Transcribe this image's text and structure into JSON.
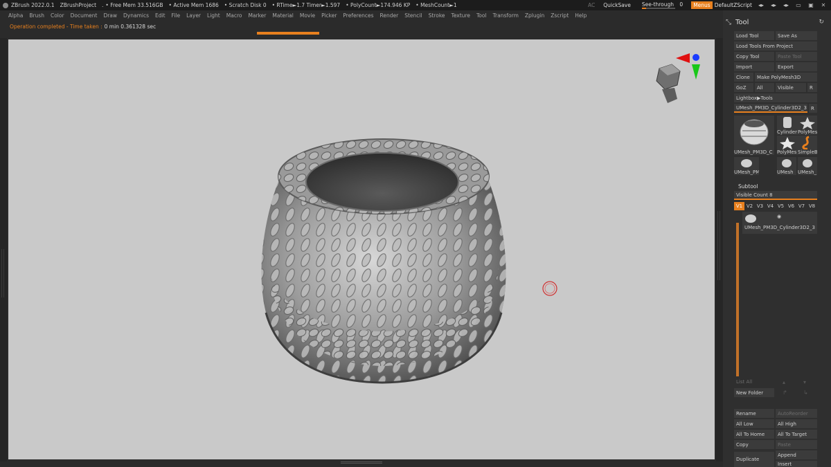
{
  "titlebar": {
    "app": "ZBrush 2022.0.1",
    "project": "ZBrushProject",
    "dot": ".",
    "free_mem": "• Free Mem 33.516GB",
    "active_mem": "• Active Mem 1686",
    "scratch": "• Scratch Disk 0",
    "rtime": "• RTime►1.7 Timer►1.597",
    "polycount": "• PolyCount►174.946 KP",
    "meshcount": "• MeshCount►1",
    "ac": "AC",
    "quicksave": "QuickSave",
    "see_through": "See-through",
    "see_through_value": "0",
    "see_through_level": 0.0,
    "menus": "Menus",
    "script": "DefaultZScript"
  },
  "menubar": {
    "items": [
      "Alpha",
      "Brush",
      "Color",
      "Document",
      "Draw",
      "Dynamics",
      "Edit",
      "File",
      "Layer",
      "Light",
      "Macro",
      "Marker",
      "Material",
      "Movie",
      "Picker",
      "Preferences",
      "Render",
      "Stencil",
      "Stroke",
      "Texture",
      "Tool",
      "Transform",
      "Zplugin",
      "Zscript",
      "Help"
    ]
  },
  "status": {
    "label": "Operation completed - Time taken :",
    "value": "0 min 0.361328 sec"
  },
  "tool_panel": {
    "title": "Tool",
    "load_tool": "Load Tool",
    "save_as": "Save As",
    "load_from_project": "Load Tools From Project",
    "copy_tool": "Copy Tool",
    "paste_tool": "Paste Tool",
    "import": "Import",
    "export": "Export",
    "clone": "Clone",
    "make_polymesh": "Make PolyMesh3D",
    "goz": "GoZ",
    "all": "All",
    "visible": "Visible",
    "r": "R",
    "lightbox": "Lightbox▶Tools",
    "current_tool": "UMesh_PM3D_Cylinder3D2_3",
    "current_tool_suffix": "R",
    "thumbs": {
      "main": "UMesh_PM3D_C",
      "cylinder": "Cylinder",
      "polymesh": "PolyMes",
      "polymesh2": "PolyMes",
      "simpleb": "SimpleB",
      "s1": "UMesh_PM3D_C",
      "s2": "UMesh",
      "s3": "UMesh_"
    },
    "subtool": {
      "title": "Subtool",
      "visible_count": "Visible Count 8",
      "tabs": [
        "V1",
        "V2",
        "V3",
        "V4",
        "V5",
        "V6",
        "V7",
        "V8"
      ],
      "item_name": "UMesh_PM3D_Cylinder3D2_3"
    },
    "list_all": "List All",
    "new_folder": "New Folder",
    "rename": "Rename",
    "autoreorder": "AutoReorder",
    "all_low": "All Low",
    "all_high": "All High",
    "all_to_home": "All To Home",
    "all_to_target": "All To Target",
    "copy": "Copy",
    "paste": "Paste",
    "duplicate": "Duplicate",
    "append": "Append",
    "insert": "Insert"
  },
  "colors": {
    "accent": "#e8801e",
    "canvas": "#c9c9c9",
    "panel": "#2f2f2f"
  }
}
